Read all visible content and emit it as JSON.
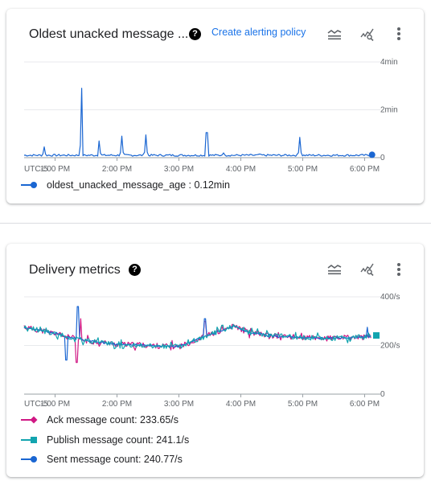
{
  "cards": [
    {
      "title": "Oldest unacked message ...",
      "help_icon": "help-circle-icon",
      "link_label": "Create alerting policy",
      "icons": [
        "legend-toggle-icon",
        "explore-chart-icon",
        "more-vert-icon"
      ]
    },
    {
      "title": "Delivery metrics",
      "help_icon": "help-circle-icon",
      "icons": [
        "legend-toggle-icon",
        "explore-chart-icon",
        "more-vert-icon"
      ]
    }
  ],
  "colors": {
    "blue": "#1a66d2",
    "magenta": "#d01884",
    "teal": "#12a4af",
    "link": "#1a73e8",
    "grid": "#e8eaed"
  },
  "chart_data": [
    {
      "type": "line",
      "title": "Oldest unacked message age",
      "xlabel": "",
      "ylabel": "",
      "timezone_label": "UTC-5",
      "x_ticks": [
        "1:00 PM",
        "2:00 PM",
        "3:00 PM",
        "4:00 PM",
        "5:00 PM",
        "6:00 PM"
      ],
      "y_ticks": [
        "0",
        "2min",
        "4min"
      ],
      "ylim_min": [
        0,
        4
      ],
      "xlim_hours": [
        12.5,
        18.15
      ],
      "grid": true,
      "legend_position": "bottom-left",
      "series": [
        {
          "name": "oldest_unacked_message_age",
          "legend_value": "0.12min",
          "color": "#1a66d2",
          "marker": "circle",
          "baseline_min": 0.1,
          "spikes": [
            {
              "x": 12.83,
              "y": 0.45
            },
            {
              "x": 13.42,
              "y": 2.9
            },
            {
              "x": 13.72,
              "y": 0.7
            },
            {
              "x": 14.08,
              "y": 0.9
            },
            {
              "x": 14.47,
              "y": 0.95
            },
            {
              "x": 15.45,
              "y": 1.05
            },
            {
              "x": 15.72,
              "y": 0.2
            },
            {
              "x": 16.3,
              "y": 0.15
            },
            {
              "x": 16.95,
              "y": 0.85
            }
          ],
          "last": {
            "x": 18.12,
            "y": 0.12
          }
        }
      ]
    },
    {
      "type": "line",
      "title": "Delivery metrics",
      "xlabel": "",
      "ylabel": "",
      "timezone_label": "UTC-5",
      "x_ticks": [
        "1:00 PM",
        "2:00 PM",
        "3:00 PM",
        "4:00 PM",
        "5:00 PM",
        "6:00 PM"
      ],
      "y_ticks": [
        "0",
        "200/s",
        "400/s"
      ],
      "ylim_per_s": [
        0,
        400
      ],
      "xlim_hours": [
        12.5,
        18.15
      ],
      "grid": true,
      "legend_position": "bottom-left",
      "trend_per_s": [
        {
          "x": 12.5,
          "y": 275
        },
        {
          "x": 13.0,
          "y": 250
        },
        {
          "x": 13.2,
          "y": 235
        },
        {
          "x": 13.5,
          "y": 220
        },
        {
          "x": 14.0,
          "y": 205
        },
        {
          "x": 14.5,
          "y": 200
        },
        {
          "x": 15.0,
          "y": 195
        },
        {
          "x": 15.5,
          "y": 245
        },
        {
          "x": 15.9,
          "y": 280
        },
        {
          "x": 16.1,
          "y": 255
        },
        {
          "x": 16.5,
          "y": 240
        },
        {
          "x": 17.0,
          "y": 232
        },
        {
          "x": 17.5,
          "y": 230
        },
        {
          "x": 18.1,
          "y": 235
        }
      ],
      "series": [
        {
          "name": "Ack message count",
          "legend_value": "233.65/s",
          "color": "#d01884",
          "marker": "diamond",
          "spikes": [
            {
              "x": 13.35,
              "y": 130
            },
            {
              "x": 13.42,
              "y": 310
            },
            {
              "x": 15.42,
              "y": 300
            }
          ]
        },
        {
          "name": "Publish message count",
          "legend_value": "241.1/s",
          "color": "#12a4af",
          "marker": "square",
          "spikes": []
        },
        {
          "name": "Sent message count",
          "legend_value": "240.77/s",
          "color": "#1a66d2",
          "marker": "circle",
          "spikes": [
            {
              "x": 13.18,
              "y": 140
            },
            {
              "x": 13.37,
              "y": 360
            },
            {
              "x": 15.42,
              "y": 310
            },
            {
              "x": 18.05,
              "y": 275
            }
          ]
        }
      ]
    }
  ]
}
